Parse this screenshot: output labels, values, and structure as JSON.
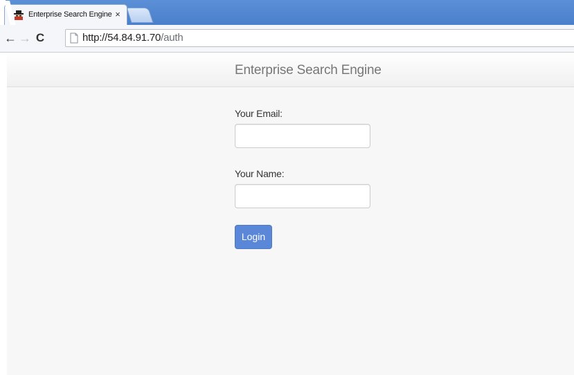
{
  "browser": {
    "tab": {
      "title": "Enterprise Search Engine",
      "close_glyph": "×",
      "favicon": "spy-icon"
    },
    "toolbar": {
      "back_glyph": "←",
      "forward_glyph": "→",
      "reload_glyph": "C",
      "url_host": "http://54.84.91.70",
      "url_path": "/auth"
    }
  },
  "page": {
    "brand": "Enterprise Search Engine",
    "form": {
      "email_label": "Your Email:",
      "email_value": "",
      "name_label": "Your Name:",
      "name_value": "",
      "login_label": "Login"
    }
  },
  "colors": {
    "tab_strip": "#4a7fcb",
    "login_button": "#5b87d8",
    "brand_text": "#777777"
  }
}
